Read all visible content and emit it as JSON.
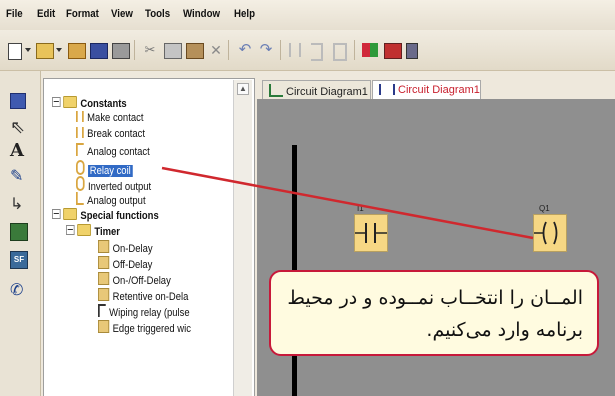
{
  "menu": [
    "File",
    "Edit",
    "Format",
    "View",
    "Tools",
    "Window",
    "Help"
  ],
  "tabs": [
    {
      "label": "Circuit Diagram1",
      "active": false
    },
    {
      "label": "Circuit Diagram1",
      "active": true
    }
  ],
  "tree": {
    "constants_label": "Constants",
    "constants_items": [
      "Make contact",
      "Break contact",
      "Analog contact",
      "Relay coil",
      "Inverted output",
      "Analog output"
    ],
    "selected_item": "Relay coil",
    "special_label": "Special functions",
    "timer_label": "Timer",
    "timer_items": [
      "On-Delay",
      "Off-Delay",
      "On-/Off-Delay",
      "Retentive on-Dela",
      "Wiping relay (pulse",
      "Edge triggered wic"
    ]
  },
  "diagram": {
    "contact_label": "I1",
    "coil_label": "Q1"
  },
  "callout": {
    "text": "المــان را انتخــاب نمــوده و در محیط برنامه وارد می‌کنیم."
  },
  "colors": {
    "callout_border": "#c7193a",
    "pointer_line": "#d0282e",
    "block_fill": "#f6d784",
    "selection": "#316ac5"
  },
  "icons": {
    "toolbar": [
      "new-icon",
      "open-icon",
      "open-folder-icon",
      "save-icon",
      "print-icon",
      "cut-icon",
      "copy-icon",
      "paste-icon",
      "delete-icon",
      "undo-icon",
      "redo-icon",
      "insert-connector-icon",
      "align-icon",
      "text-icon",
      "simulation-icon",
      "transfer-icon"
    ],
    "left": [
      "select-icon",
      "pointer-icon",
      "text-tool-icon",
      "connect-icon",
      "cut-connection-icon",
      "constants-icon",
      "special-functions-icon",
      "simulation-tool-icon"
    ]
  }
}
